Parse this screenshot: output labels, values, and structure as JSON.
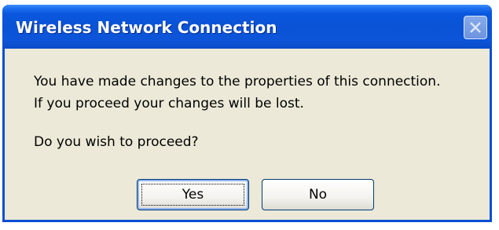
{
  "dialog": {
    "title": "Wireless Network Connection",
    "message_line1": "You have made changes to the properties of this connection.",
    "message_line2": "If you proceed your changes will be lost.",
    "question": "Do you wish to proceed?",
    "buttons": {
      "yes_label": "Yes",
      "no_label": "No"
    },
    "close_icon": "close-icon"
  },
  "colors": {
    "titlebar": "#0a52d6",
    "dialog_background": "#ece9d8",
    "button_border": "#003c74"
  }
}
